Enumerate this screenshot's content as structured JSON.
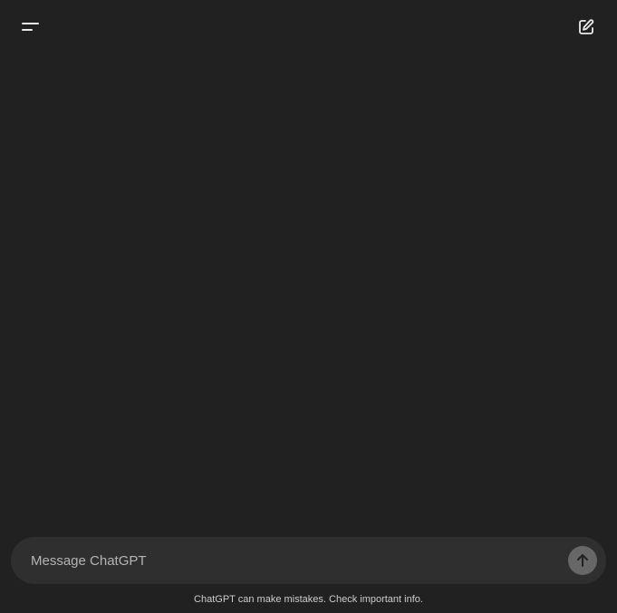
{
  "header": {
    "menu_icon": "hamburger-menu-icon",
    "new_chat_icon": "edit-pencil-icon"
  },
  "composer": {
    "placeholder": "Message ChatGPT",
    "value": "",
    "send_icon": "arrow-up-icon"
  },
  "footer": {
    "disclaimer": "ChatGPT can make mistakes. Check important info."
  },
  "colors": {
    "background": "#212121",
    "composer_bg": "#2f2f2f",
    "send_button_bg": "#676767",
    "text_muted": "#b4b4b4"
  }
}
